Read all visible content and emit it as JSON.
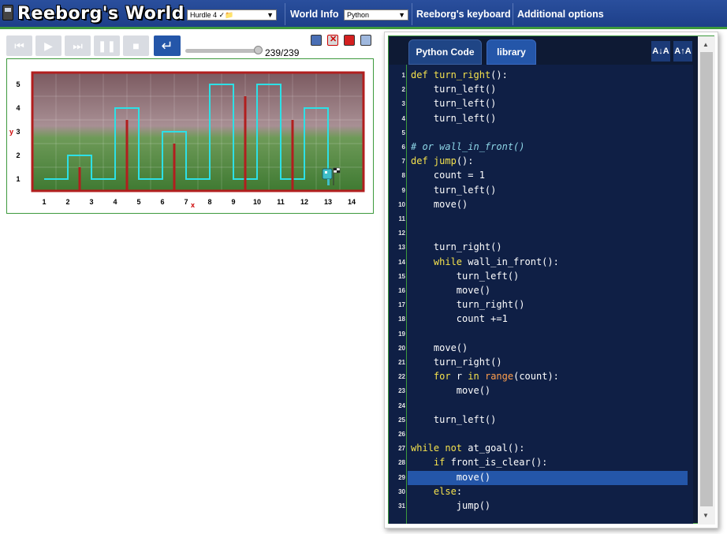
{
  "app": {
    "title": "Reeborg's World"
  },
  "header": {
    "world_select": "Hurdle 4 ✓📁",
    "world_info": "World Info",
    "language_select": "Python",
    "keyboard": "Reeborg's keyboard",
    "options": "Additional options"
  },
  "playback": {
    "counter": "239/239",
    "progress": 1.0,
    "buttons": [
      "first-step",
      "play",
      "last-step",
      "pause",
      "stop",
      "step-back"
    ]
  },
  "world": {
    "x_ticks": [
      "1",
      "2",
      "3",
      "4",
      "5",
      "6",
      "7",
      "8",
      "9",
      "10",
      "11",
      "12",
      "13",
      "14"
    ],
    "y_ticks": [
      "1",
      "2",
      "3",
      "4",
      "5"
    ],
    "x_label": "x",
    "y_label": "y"
  },
  "editor": {
    "tab_code": "Python Code",
    "tab_library": "library",
    "font_decrease": "A↓A",
    "font_increase": "A↑A",
    "highlight_line": 29,
    "lines": [
      {
        "n": "1",
        "t": "def turn_right():"
      },
      {
        "n": "2",
        "t": "    turn_left()"
      },
      {
        "n": "3",
        "t": "    turn_left()"
      },
      {
        "n": "4",
        "t": "    turn_left()"
      },
      {
        "n": "5",
        "t": ""
      },
      {
        "n": "6",
        "t": "# or wall_in_front()"
      },
      {
        "n": "7",
        "t": "def jump():"
      },
      {
        "n": "8",
        "t": "    count = 1"
      },
      {
        "n": "9",
        "t": "    turn_left()"
      },
      {
        "n": "10",
        "t": "    move()"
      },
      {
        "n": "11",
        "t": ""
      },
      {
        "n": "12",
        "t": ""
      },
      {
        "n": "13",
        "t": "    turn_right()"
      },
      {
        "n": "14",
        "t": "    while wall_in_front():"
      },
      {
        "n": "15",
        "t": "        turn_left()"
      },
      {
        "n": "16",
        "t": "        move()"
      },
      {
        "n": "17",
        "t": "        turn_right()"
      },
      {
        "n": "18",
        "t": "        count +=1"
      },
      {
        "n": "19",
        "t": ""
      },
      {
        "n": "20",
        "t": "    move()"
      },
      {
        "n": "21",
        "t": "    turn_right()"
      },
      {
        "n": "22",
        "t": "    for r in range(count):"
      },
      {
        "n": "23",
        "t": "        move()"
      },
      {
        "n": "24",
        "t": ""
      },
      {
        "n": "25",
        "t": "    turn_left()"
      },
      {
        "n": "26",
        "t": ""
      },
      {
        "n": "27",
        "t": "while not at_goal():"
      },
      {
        "n": "28",
        "t": "    if front_is_clear():"
      },
      {
        "n": "29",
        "t": "        move()"
      },
      {
        "n": "30",
        "t": "    else:"
      },
      {
        "n": "31",
        "t": "        jump()"
      }
    ]
  },
  "colors": {
    "header": "#1d3f89",
    "accent_green": "#3d9a3d",
    "editor_bg": "#0f1f45",
    "keyword": "#f5e24d",
    "comment": "#8dd5e6",
    "builtin": "#ff9f4d",
    "wall": "#b21e1e",
    "trace": "#2de0e6"
  }
}
